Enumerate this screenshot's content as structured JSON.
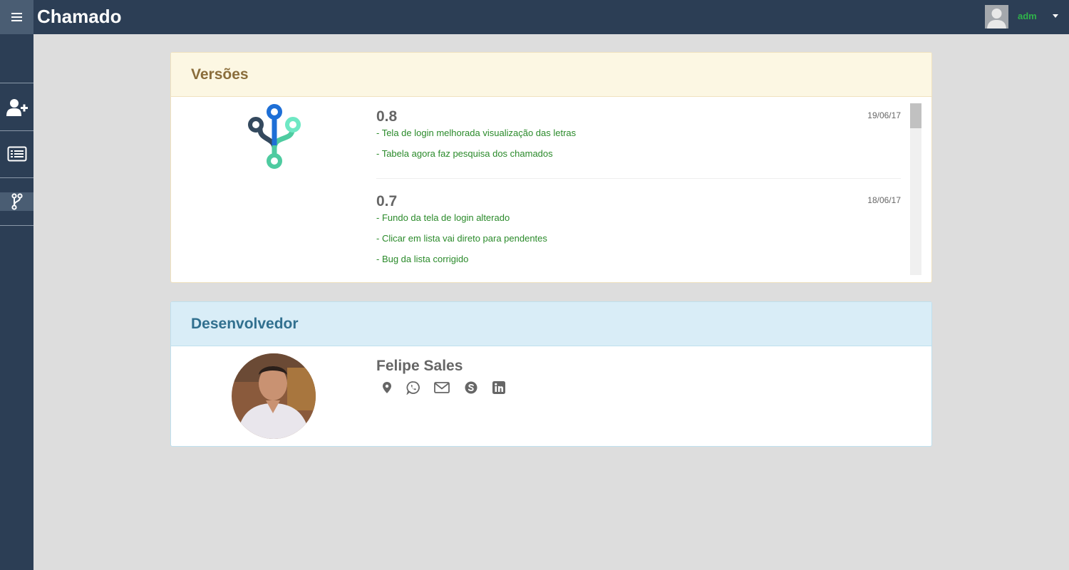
{
  "header": {
    "title": "Chamado",
    "menu_icon": "menu-icon",
    "user": {
      "name": "adm",
      "name_color": "#2fb34a",
      "avatar_icon": "user-avatar-icon",
      "dropdown_icon": "caret-down-icon"
    }
  },
  "sidebar": {
    "items": [
      {
        "icon": "add-user-icon",
        "active": false
      },
      {
        "icon": "list-icon",
        "active": false
      },
      {
        "icon": "code-branch-icon",
        "active": true
      }
    ]
  },
  "versions_panel": {
    "title": "Versões",
    "logo_icon": "git-branch-logo-icon",
    "versions": [
      {
        "number": "0.8",
        "date": "19/06/17",
        "changes": [
          "- Tela de login melhorada visualização das letras",
          "- Tabela agora faz pesquisa dos chamados"
        ]
      },
      {
        "number": "0.7",
        "date": "18/06/17",
        "changes": [
          "- Fundo da tela de login alterado",
          "- Clicar em lista vai direto para pendentes",
          "- Bug da lista corrigido"
        ]
      }
    ]
  },
  "developer_panel": {
    "title": "Desenvolvedor",
    "name": "Felipe Sales",
    "photo_icon": "developer-photo",
    "social_icons": [
      "map-marker-icon",
      "whatsapp-icon",
      "email-icon",
      "skype-icon",
      "linkedin-icon"
    ]
  },
  "colors": {
    "topbar": "#2c3e55",
    "sidebar_active": "#4a5d73",
    "background": "#dddddd",
    "warning_heading": "#fcf7e3",
    "info_heading": "#d9edf7",
    "change_text": "#2a8a2a"
  }
}
